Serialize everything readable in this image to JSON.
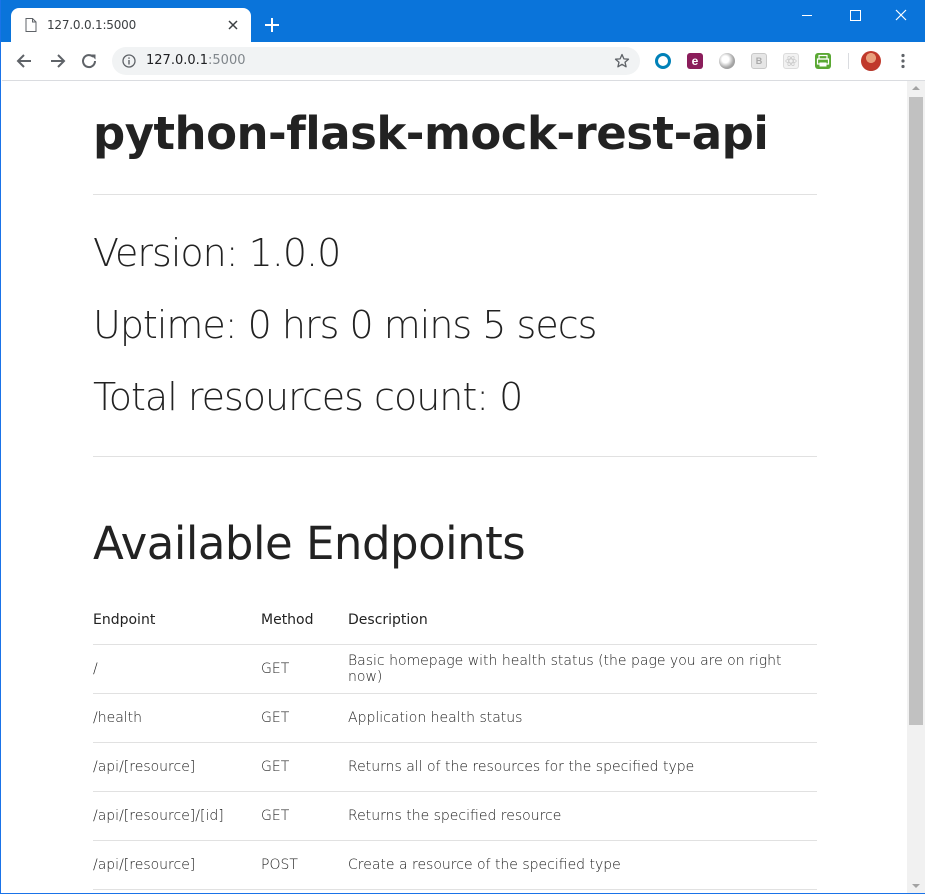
{
  "browser": {
    "tab_title": "127.0.0.1:5000",
    "url_host": "127.0.0.1",
    "url_port": ":5000"
  },
  "page": {
    "title": "python-flask-mock-rest-api",
    "version_text": "Version: 1.0.0",
    "uptime_text": "Uptime: 0 hrs 0 mins 5 secs",
    "resources_text": "Total resources count: 0",
    "endpoints_heading": "Available Endpoints"
  },
  "table": {
    "headers": [
      "Endpoint",
      "Method",
      "Description"
    ],
    "rows": [
      {
        "endpoint": "/",
        "method": "GET",
        "description": "Basic homepage with health status (the page you are on right now)"
      },
      {
        "endpoint": "/health",
        "method": "GET",
        "description": "Application health status"
      },
      {
        "endpoint": "/api/[resource]",
        "method": "GET",
        "description": "Returns all of the resources for the specified type"
      },
      {
        "endpoint": "/api/[resource]/[id]",
        "method": "GET",
        "description": "Returns the specified resource"
      },
      {
        "endpoint": "/api/[resource]",
        "method": "POST",
        "description": "Create a resource of the specified type"
      }
    ]
  },
  "icons": {
    "extension_e_letter": "e",
    "extension_b_letter": "B"
  },
  "colors": {
    "titlebar": "#0a74da",
    "text": "#222222",
    "rule": "#e1e1e1"
  }
}
